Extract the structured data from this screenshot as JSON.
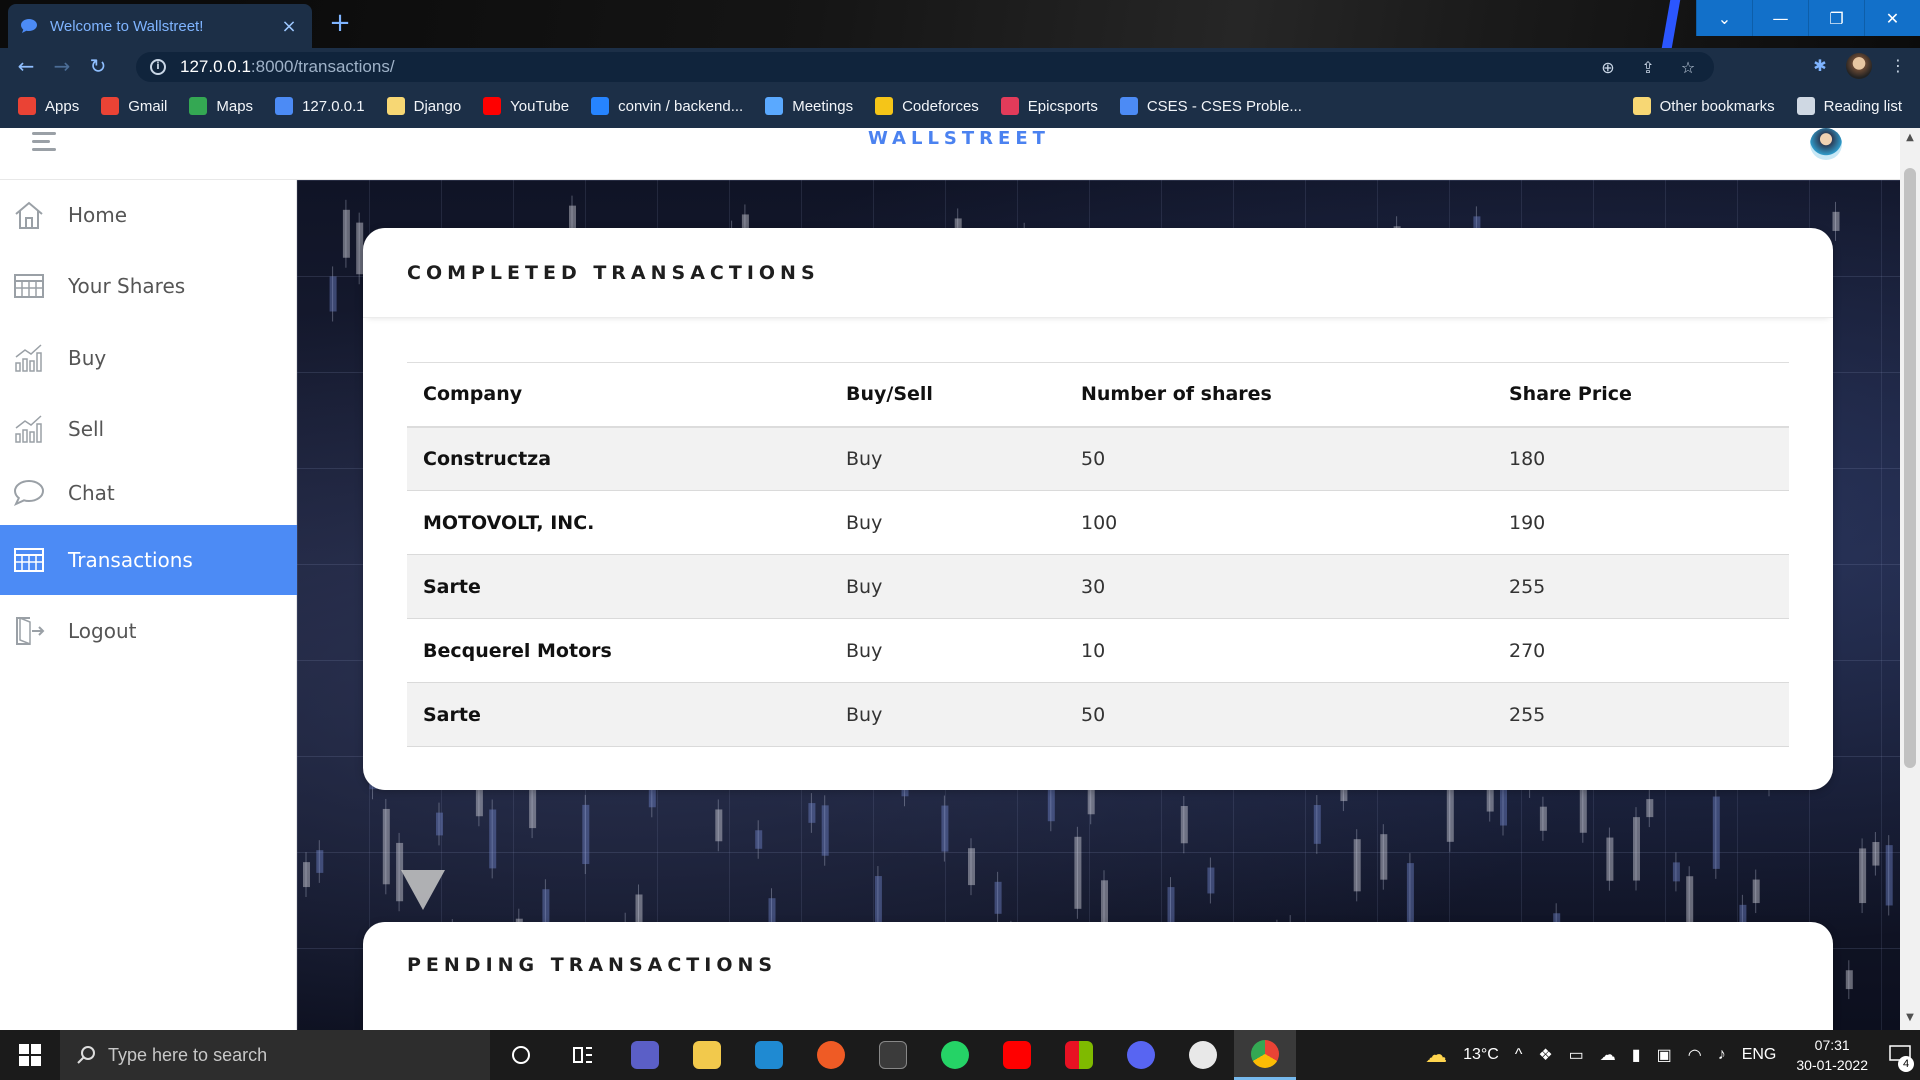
{
  "browser": {
    "tab_title": "Welcome to Wallstreet!",
    "tab_close": "×",
    "new_tab": "+",
    "url_host": "127.0.0.1",
    "url_path": ":8000/transactions/",
    "bookmarks": [
      {
        "label": "Apps",
        "icon": "apps-grid-icon",
        "color": "#ea4335"
      },
      {
        "label": "Gmail",
        "icon": "gmail-icon",
        "color": "#ea4335"
      },
      {
        "label": "Maps",
        "icon": "maps-icon",
        "color": "#34a853"
      },
      {
        "label": "127.0.0.1",
        "icon": "chat-bubble-icon",
        "color": "#4c8bf5"
      },
      {
        "label": "Django",
        "icon": "folder-icon",
        "color": "#f7d774"
      },
      {
        "label": "YouTube",
        "icon": "youtube-icon",
        "color": "#ff0000"
      },
      {
        "label": "convin / backend...",
        "icon": "bitbucket-icon",
        "color": "#2684ff"
      },
      {
        "label": "Meetings",
        "icon": "meetings-icon",
        "color": "#5aa9ff"
      },
      {
        "label": "Codeforces",
        "icon": "codeforces-icon",
        "color": "#f5c518"
      },
      {
        "label": "Epicsports",
        "icon": "epicsports-icon",
        "color": "#e23b5a"
      },
      {
        "label": "CSES - CSES Proble...",
        "icon": "globe-icon",
        "color": "#4c8bf5"
      }
    ],
    "other_bookmarks": "Other bookmarks",
    "reading_list": "Reading list"
  },
  "app": {
    "brand": "WALLSTREET",
    "accent": "#4c8bf5"
  },
  "sidebar": {
    "items": [
      {
        "label": "Home",
        "icon": "home-icon",
        "active": false
      },
      {
        "label": "Your Shares",
        "icon": "table-icon",
        "active": false
      },
      {
        "label": "Buy",
        "icon": "bar-chart-icon",
        "active": false
      },
      {
        "label": "Sell",
        "icon": "bar-chart-icon",
        "active": false
      },
      {
        "label": "Chat",
        "icon": "chat-icon",
        "active": false
      },
      {
        "label": "Transactions",
        "icon": "table-icon",
        "active": true
      },
      {
        "label": "Logout",
        "icon": "logout-icon",
        "active": false
      }
    ]
  },
  "completed": {
    "title": "COMPLETED TRANSACTIONS",
    "columns": [
      "Company",
      "Buy/Sell",
      "Number of shares",
      "Share Price"
    ],
    "rows": [
      [
        "Constructza",
        "Buy",
        "50",
        "180"
      ],
      [
        "MOTOVOLT, INC.",
        "Buy",
        "100",
        "190"
      ],
      [
        "Sarte",
        "Buy",
        "30",
        "255"
      ],
      [
        "Becquerel Motors",
        "Buy",
        "10",
        "270"
      ],
      [
        "Sarte",
        "Buy",
        "50",
        "255"
      ]
    ]
  },
  "pending": {
    "title": "PENDING TRANSACTIONS"
  },
  "taskbar": {
    "search_placeholder": "Type here to search",
    "weather": "13°C",
    "language": "ENG",
    "time": "07:31",
    "date": "30-01-2022",
    "notifications": "4"
  }
}
